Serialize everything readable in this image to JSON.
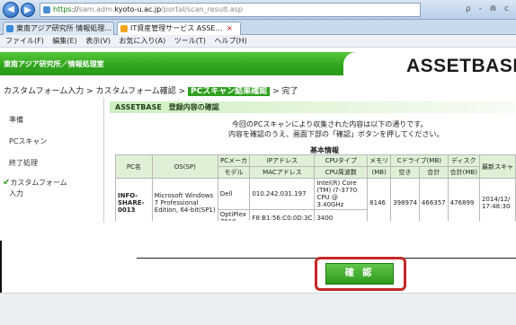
{
  "browser": {
    "url_https": "https",
    "url_prefix": "://",
    "url_blur": "sam.adm.",
    "url_host": "kyoto-u.ac.jp",
    "url_path": "/portal/scan_result.asp",
    "url_icons": "ρ - ⋒ c",
    "tabs": [
      {
        "label": "東南アジア研究所 情報処理…",
        "active": false
      },
      {
        "label": "IT資産管理サービス ASSE…",
        "active": true,
        "close": "×"
      }
    ],
    "menu": [
      "ファイル(F)",
      "編集(E)",
      "表示(V)",
      "お気に入り(A)",
      "ツール(T)",
      "ヘルプ(H)"
    ]
  },
  "site": {
    "name": "東南アジア研究所／情報処理室",
    "logo": "ASSETBASE"
  },
  "breadcrumb": {
    "items": [
      "カスタムフォーム入力",
      ">",
      "カスタムフォーム確認",
      ">"
    ],
    "current": "PCスキャン結果確認",
    "after": "> 完了"
  },
  "sidebar": {
    "items": [
      {
        "label": "準備"
      },
      {
        "label": "PCスキャン"
      },
      {
        "label": "終了処理"
      },
      {
        "label": "カスタムフォーム",
        "label2": "入力",
        "check": "✔",
        "active": true
      }
    ]
  },
  "main": {
    "title": "ASSETBASE　登録内容の確認",
    "intro_line1": "今回のPCスキャンにより収集された内容は以下の通りです。",
    "intro_line2": "内容を確認のうえ、画面下部の「確認」ボタンを押してください。",
    "section_title": "基本情報"
  },
  "table": {
    "headers_top": [
      "PC名",
      "OS(SP)",
      "PCメーカ",
      "IPアドレス",
      "CPUタイプ",
      "メモリ",
      "Cドライブ(MB)",
      "ディスク",
      "最新スキャ"
    ],
    "headers_sub": [
      "モデル",
      "MACアドレス",
      "CPU周波数",
      "(MB)",
      "空き",
      "合計",
      "合計(MB)"
    ],
    "row": {
      "pc": "INFO-SHARE-0013",
      "os": "Microsoft Windows 7 Professional Edition, 64-bit(SP1)",
      "maker": "Dell",
      "ip": "010.242.031.197",
      "cpu": "Intel(R) Core (TM) i7-3770 CPU @ 3.40GHz",
      "memory": "8146",
      "c_free": "398974",
      "c_total": "466357",
      "disk_total": "476899",
      "scan": "2014/12/ 17:48:30",
      "model": "OptiPlex 7010",
      "mac": "F8:B1:56:C0:0D:3C",
      "freq": "3400"
    }
  },
  "confirm_label": "確 認",
  "colors": {
    "accent": "#2ea01e",
    "highlight": "#c62828"
  }
}
